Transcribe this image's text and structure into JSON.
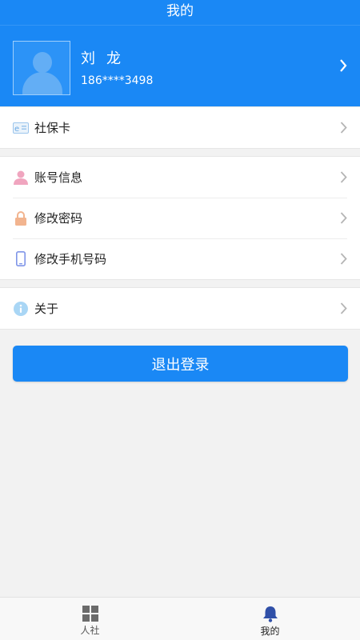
{
  "header": {
    "title": "我的"
  },
  "profile": {
    "name": "刘龙",
    "phone": "186****3498"
  },
  "menu": {
    "group1": [
      {
        "label": "社保卡",
        "icon": "card-icon"
      }
    ],
    "group2": [
      {
        "label": "账号信息",
        "icon": "user-icon"
      },
      {
        "label": "修改密码",
        "icon": "lock-icon"
      },
      {
        "label": "修改手机号码",
        "icon": "phone-icon"
      }
    ],
    "group3": [
      {
        "label": "关于",
        "icon": "info-icon"
      }
    ]
  },
  "logout_label": "退出登录",
  "tabbar": [
    {
      "label": "人社",
      "icon": "grid-icon",
      "active": false
    },
    {
      "label": "我的",
      "icon": "bell-icon",
      "active": true
    }
  ],
  "colors": {
    "primary": "#1a88f5",
    "background": "#f2f2f2",
    "active_tab": "#3050a8"
  }
}
